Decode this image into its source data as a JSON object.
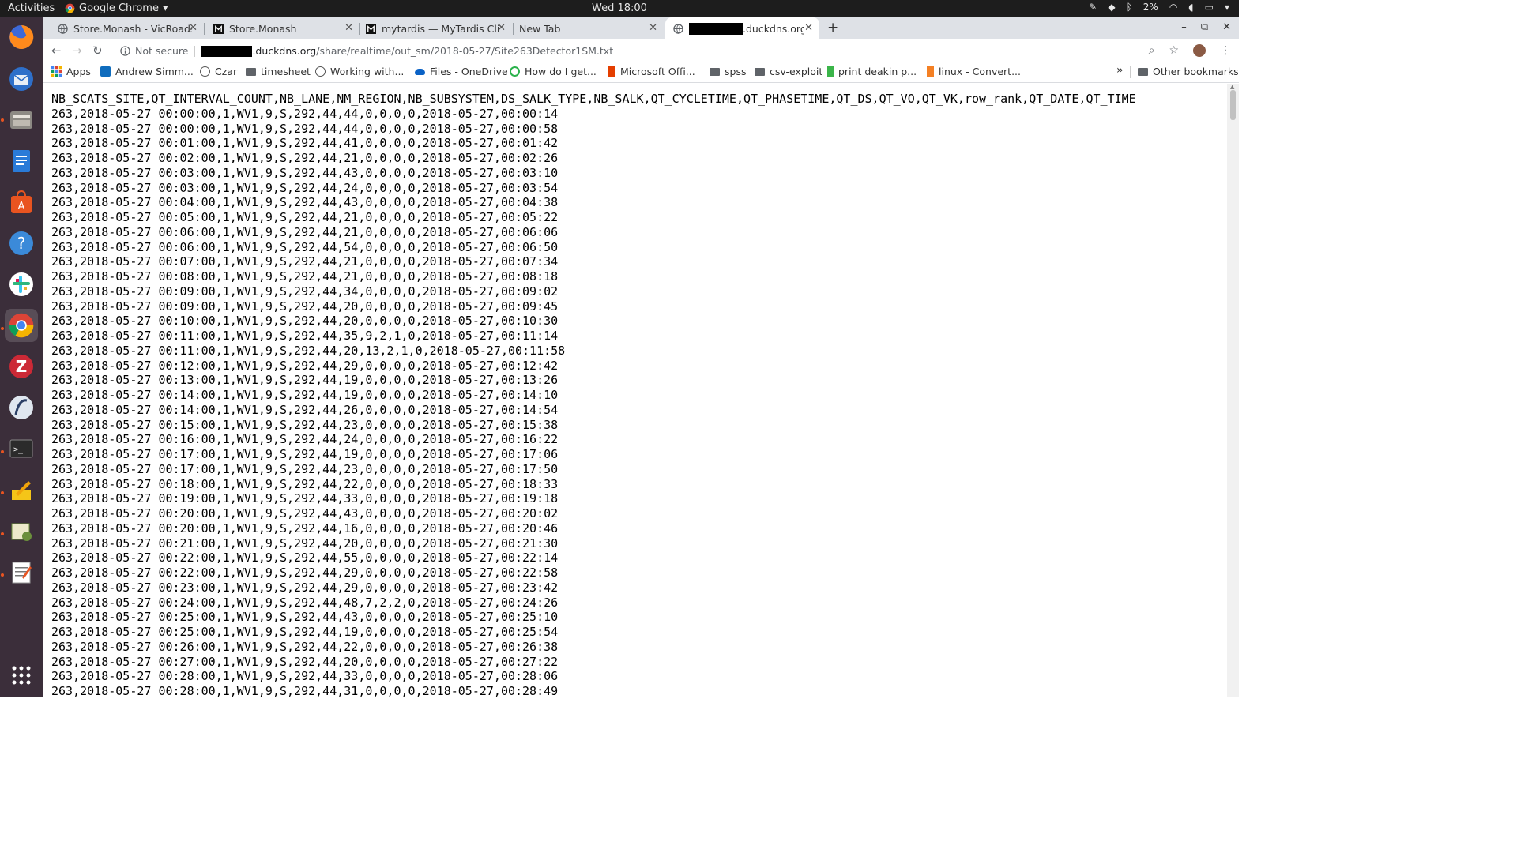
{
  "topbar": {
    "activities": "Activities",
    "app_name": "Google Chrome",
    "clock": "Wed 18:00",
    "battery": "2%"
  },
  "dock": {
    "apps": [
      "firefox-icon",
      "thunderbird-icon",
      "files-icon",
      "writer-icon",
      "software-center-icon",
      "help-icon",
      "slack-icon",
      "chrome-icon",
      "zotero-icon",
      "jupyter-icon",
      "terminal-icon",
      "notes-icon",
      "gedit-icon",
      "text-editor-icon",
      "show-apps-icon"
    ]
  },
  "tabs": [
    {
      "title": "Store.Monash - VicRoads"
    },
    {
      "title": "Store.Monash"
    },
    {
      "title": "mytardis — MyTardis Client"
    },
    {
      "title": "New Tab"
    },
    {
      "title": ".duckdns.org"
    }
  ],
  "toolbar": {
    "security": "Not secure",
    "url_host": ".duckdns.org",
    "url_path": "/share/realtime/out_sm/2018-05-27/Site263Detector1SM.txt"
  },
  "bookmarks": {
    "items": [
      "Apps",
      "Andrew Simm...",
      "Czar",
      "timesheet",
      "Working with...",
      "Files - OneDrive",
      "How do I get...",
      "Microsoft Offi...",
      "spss",
      "csv-exploit",
      "print deakin p...",
      "linux - Convert..."
    ],
    "more": "»",
    "other": "Other bookmarks"
  },
  "document": {
    "lines": [
      "NB_SCATS_SITE,QT_INTERVAL_COUNT,NB_LANE,NM_REGION,NB_SUBSYSTEM,DS_SALK_TYPE,NB_SALK,QT_CYCLETIME,QT_PHASETIME,QT_DS,QT_VO,QT_VK,row_rank,QT_DATE,QT_TIME",
      "263,2018-05-27 00:00:00,1,WV1,9,S,292,44,44,0,0,0,0,2018-05-27,00:00:14",
      "263,2018-05-27 00:00:00,1,WV1,9,S,292,44,44,0,0,0,0,2018-05-27,00:00:58",
      "263,2018-05-27 00:01:00,1,WV1,9,S,292,44,41,0,0,0,0,2018-05-27,00:01:42",
      "263,2018-05-27 00:02:00,1,WV1,9,S,292,44,21,0,0,0,0,2018-05-27,00:02:26",
      "263,2018-05-27 00:03:00,1,WV1,9,S,292,44,43,0,0,0,0,2018-05-27,00:03:10",
      "263,2018-05-27 00:03:00,1,WV1,9,S,292,44,24,0,0,0,0,2018-05-27,00:03:54",
      "263,2018-05-27 00:04:00,1,WV1,9,S,292,44,43,0,0,0,0,2018-05-27,00:04:38",
      "263,2018-05-27 00:05:00,1,WV1,9,S,292,44,21,0,0,0,0,2018-05-27,00:05:22",
      "263,2018-05-27 00:06:00,1,WV1,9,S,292,44,21,0,0,0,0,2018-05-27,00:06:06",
      "263,2018-05-27 00:06:00,1,WV1,9,S,292,44,54,0,0,0,0,2018-05-27,00:06:50",
      "263,2018-05-27 00:07:00,1,WV1,9,S,292,44,21,0,0,0,0,2018-05-27,00:07:34",
      "263,2018-05-27 00:08:00,1,WV1,9,S,292,44,21,0,0,0,0,2018-05-27,00:08:18",
      "263,2018-05-27 00:09:00,1,WV1,9,S,292,44,34,0,0,0,0,2018-05-27,00:09:02",
      "263,2018-05-27 00:09:00,1,WV1,9,S,292,44,20,0,0,0,0,2018-05-27,00:09:45",
      "263,2018-05-27 00:10:00,1,WV1,9,S,292,44,20,0,0,0,0,2018-05-27,00:10:30",
      "263,2018-05-27 00:11:00,1,WV1,9,S,292,44,35,9,2,1,0,2018-05-27,00:11:14",
      "263,2018-05-27 00:11:00,1,WV1,9,S,292,44,20,13,2,1,0,2018-05-27,00:11:58",
      "263,2018-05-27 00:12:00,1,WV1,9,S,292,44,29,0,0,0,0,2018-05-27,00:12:42",
      "263,2018-05-27 00:13:00,1,WV1,9,S,292,44,19,0,0,0,0,2018-05-27,00:13:26",
      "263,2018-05-27 00:14:00,1,WV1,9,S,292,44,19,0,0,0,0,2018-05-27,00:14:10",
      "263,2018-05-27 00:14:00,1,WV1,9,S,292,44,26,0,0,0,0,2018-05-27,00:14:54",
      "263,2018-05-27 00:15:00,1,WV1,9,S,292,44,23,0,0,0,0,2018-05-27,00:15:38",
      "263,2018-05-27 00:16:00,1,WV1,9,S,292,44,24,0,0,0,0,2018-05-27,00:16:22",
      "263,2018-05-27 00:17:00,1,WV1,9,S,292,44,19,0,0,0,0,2018-05-27,00:17:06",
      "263,2018-05-27 00:17:00,1,WV1,9,S,292,44,23,0,0,0,0,2018-05-27,00:17:50",
      "263,2018-05-27 00:18:00,1,WV1,9,S,292,44,22,0,0,0,0,2018-05-27,00:18:33",
      "263,2018-05-27 00:19:00,1,WV1,9,S,292,44,33,0,0,0,0,2018-05-27,00:19:18",
      "263,2018-05-27 00:20:00,1,WV1,9,S,292,44,43,0,0,0,0,2018-05-27,00:20:02",
      "263,2018-05-27 00:20:00,1,WV1,9,S,292,44,16,0,0,0,0,2018-05-27,00:20:46",
      "263,2018-05-27 00:21:00,1,WV1,9,S,292,44,20,0,0,0,0,2018-05-27,00:21:30",
      "263,2018-05-27 00:22:00,1,WV1,9,S,292,44,55,0,0,0,0,2018-05-27,00:22:14",
      "263,2018-05-27 00:22:00,1,WV1,9,S,292,44,29,0,0,0,0,2018-05-27,00:22:58",
      "263,2018-05-27 00:23:00,1,WV1,9,S,292,44,29,0,0,0,0,2018-05-27,00:23:42",
      "263,2018-05-27 00:24:00,1,WV1,9,S,292,44,48,7,2,2,0,2018-05-27,00:24:26",
      "263,2018-05-27 00:25:00,1,WV1,9,S,292,44,43,0,0,0,0,2018-05-27,00:25:10",
      "263,2018-05-27 00:25:00,1,WV1,9,S,292,44,19,0,0,0,0,2018-05-27,00:25:54",
      "263,2018-05-27 00:26:00,1,WV1,9,S,292,44,22,0,0,0,0,2018-05-27,00:26:38",
      "263,2018-05-27 00:27:00,1,WV1,9,S,292,44,20,0,0,0,0,2018-05-27,00:27:22",
      "263,2018-05-27 00:28:00,1,WV1,9,S,292,44,33,0,0,0,0,2018-05-27,00:28:06",
      "263,2018-05-27 00:28:00,1,WV1,9,S,292,44,31,0,0,0,0,2018-05-27,00:28:49"
    ]
  }
}
